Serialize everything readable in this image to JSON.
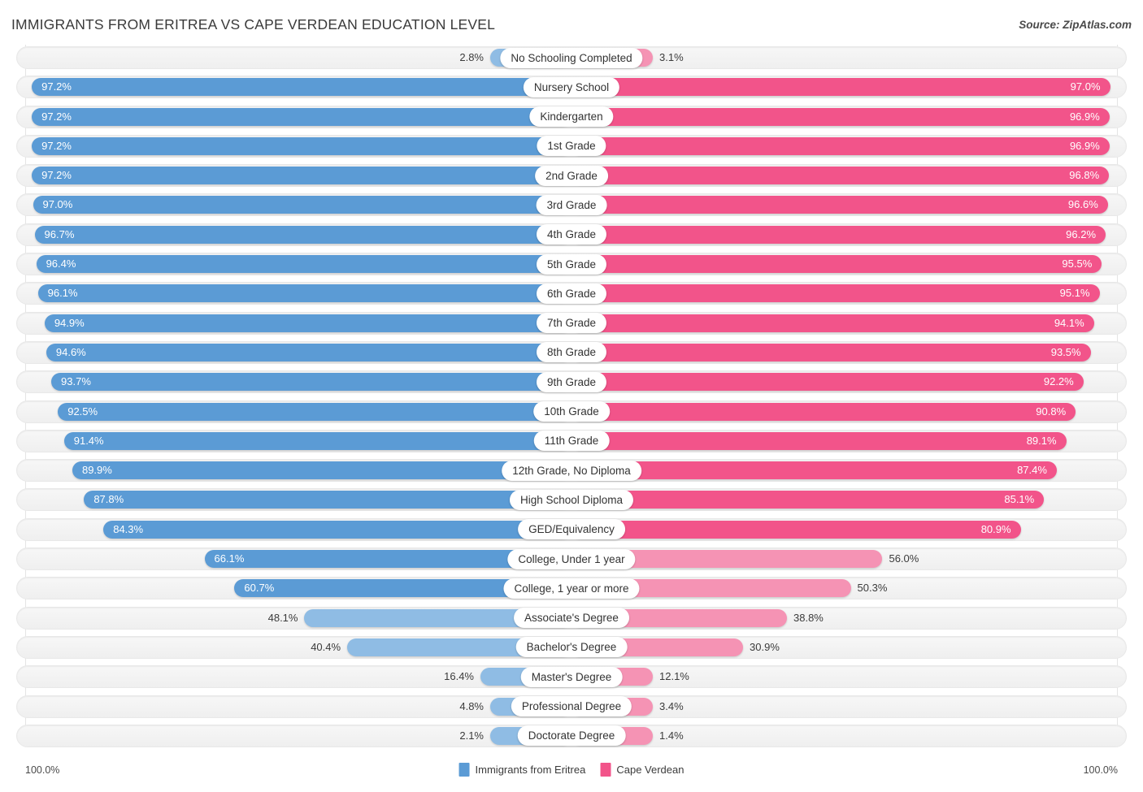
{
  "header": {
    "title": "IMMIGRANTS FROM ERITREA VS CAPE VERDEAN EDUCATION LEVEL",
    "source": "Source: ZipAtlas.com"
  },
  "footer": {
    "axis_left": "100.0%",
    "axis_right": "100.0%"
  },
  "colors": {
    "blue_strong": "#5b9bd5",
    "blue_light": "#8fbce4",
    "pink_strong": "#f2548a",
    "pink_light": "#f593b4",
    "track": "#f2f2f2",
    "gridline": "#e4e4e4"
  },
  "chart_data": {
    "type": "bar",
    "orientation": "horizontal-diverging",
    "title": "IMMIGRANTS FROM ERITREA VS CAPE VERDEAN EDUCATION LEVEL",
    "xlabel": "",
    "ylabel": "",
    "xlim": [
      0,
      100
    ],
    "grid": true,
    "legend_position": "bottom-center",
    "axis_end_labels": [
      "100.0%",
      "100.0%"
    ],
    "series": [
      {
        "name": "Immigrants from Eritrea",
        "side": "left",
        "color": "#5b9bd5",
        "values": [
          2.8,
          97.2,
          97.2,
          97.2,
          97.2,
          97.0,
          96.7,
          96.4,
          96.1,
          94.9,
          94.6,
          93.7,
          92.5,
          91.4,
          89.9,
          87.8,
          84.3,
          66.1,
          60.7,
          48.1,
          40.4,
          16.4,
          4.8,
          2.1
        ],
        "labels": [
          "2.8%",
          "97.2%",
          "97.2%",
          "97.2%",
          "97.2%",
          "97.0%",
          "96.7%",
          "96.4%",
          "96.1%",
          "94.9%",
          "94.6%",
          "93.7%",
          "92.5%",
          "91.4%",
          "89.9%",
          "87.8%",
          "84.3%",
          "66.1%",
          "60.7%",
          "48.1%",
          "40.4%",
          "16.4%",
          "4.8%",
          "2.1%"
        ]
      },
      {
        "name": "Cape Verdean",
        "side": "right",
        "color": "#f2548a",
        "values": [
          3.1,
          97.0,
          96.9,
          96.9,
          96.8,
          96.6,
          96.2,
          95.5,
          95.1,
          94.1,
          93.5,
          92.2,
          90.8,
          89.1,
          87.4,
          85.1,
          80.9,
          56.0,
          50.3,
          38.8,
          30.9,
          12.1,
          3.4,
          1.4
        ],
        "labels": [
          "3.1%",
          "97.0%",
          "96.9%",
          "96.9%",
          "96.8%",
          "96.6%",
          "96.2%",
          "95.5%",
          "95.1%",
          "94.1%",
          "93.5%",
          "92.2%",
          "90.8%",
          "89.1%",
          "87.4%",
          "85.1%",
          "80.9%",
          "56.0%",
          "50.3%",
          "38.8%",
          "30.9%",
          "12.1%",
          "3.4%",
          "1.4%"
        ]
      }
    ],
    "categories": [
      "No Schooling Completed",
      "Nursery School",
      "Kindergarten",
      "1st Grade",
      "2nd Grade",
      "3rd Grade",
      "4th Grade",
      "5th Grade",
      "6th Grade",
      "7th Grade",
      "8th Grade",
      "9th Grade",
      "10th Grade",
      "11th Grade",
      "12th Grade, No Diploma",
      "High School Diploma",
      "GED/Equivalency",
      "College, Under 1 year",
      "College, 1 year or more",
      "Associate's Degree",
      "Bachelor's Degree",
      "Master's Degree",
      "Professional Degree",
      "Doctorate Degree"
    ],
    "legend": [
      {
        "label": "Immigrants from Eritrea",
        "color": "#5b9bd5"
      },
      {
        "label": "Cape Verdean",
        "color": "#f2548a"
      }
    ]
  }
}
